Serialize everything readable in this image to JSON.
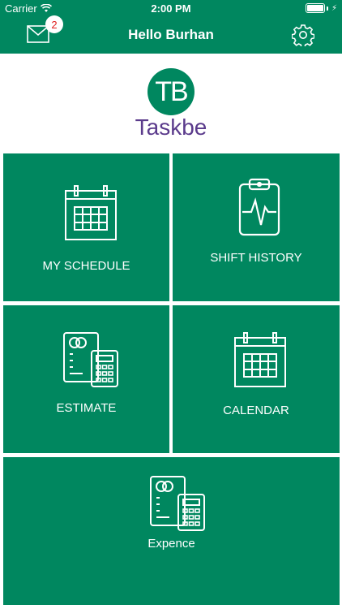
{
  "status_bar": {
    "carrier": "Carrier",
    "time": "2:00 PM"
  },
  "header": {
    "title": "Hello Burhan",
    "mail_badge": "2"
  },
  "logo": {
    "initials": "TB",
    "name": "Taskbe"
  },
  "tiles": [
    {
      "label": "MY SCHEDULE",
      "icon": "calendar-icon"
    },
    {
      "label": "SHIFT HISTORY",
      "icon": "clipboard-heartbeat-icon"
    },
    {
      "label": "ESTIMATE",
      "icon": "calculator-document-icon"
    },
    {
      "label": "CALENDAR",
      "icon": "calendar-icon"
    },
    {
      "label": "Expence",
      "icon": "calculator-document-icon"
    }
  ],
  "colors": {
    "primary": "#00875f",
    "logo_text": "#5b3b8c",
    "badge_text": "#e02020"
  }
}
